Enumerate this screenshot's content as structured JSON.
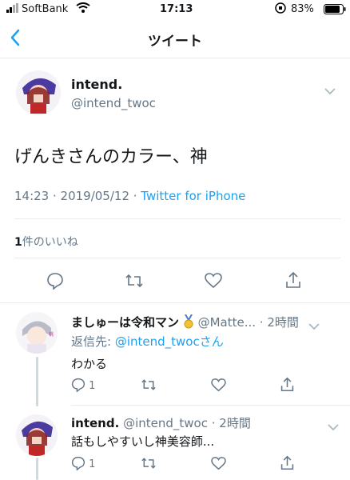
{
  "status": {
    "carrier": "SoftBank",
    "time": "17:13",
    "battery": "83%"
  },
  "nav": {
    "title": "ツイート"
  },
  "tweet": {
    "name": "intend.",
    "handle": "@intend_twoc",
    "text": "げんきさんのカラー、神",
    "time_date": "14:23 · 2019/05/12 · ",
    "source": "Twitter for iPhone",
    "likes_count": "1",
    "likes_label": "件のいいね"
  },
  "reply1": {
    "name": "ましゅーは令和マン",
    "handle": "@Matte...",
    "time": "· 2時間",
    "reply_to_prefix": "返信先: ",
    "reply_to_handle": "@intend_twoc",
    "reply_to_suffix": "さん",
    "text": "わかる",
    "reply_count": "1"
  },
  "reply2": {
    "name": "intend.",
    "handle": "@intend_twoc",
    "time": "· 2時間",
    "text": "話もしやすいし神美容師...",
    "reply_count": "1"
  }
}
